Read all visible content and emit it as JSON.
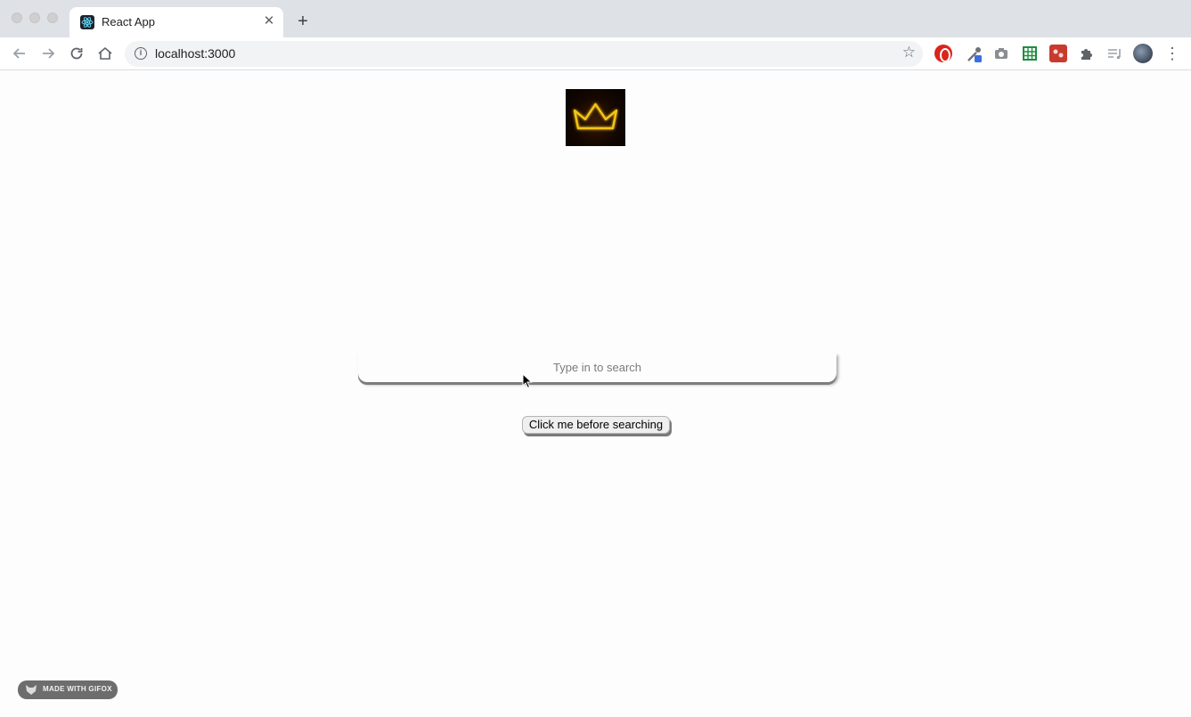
{
  "browser": {
    "tab": {
      "title": "React App",
      "favicon": "react-logo-icon",
      "close_glyph": "✕"
    },
    "new_tab_glyph": "+",
    "address": {
      "url": "localhost:3000",
      "info_glyph": "i"
    },
    "star_glyph": "☆",
    "extensions": [
      "opera-adblock-icon",
      "color-dropper-icon",
      "camera-icon",
      "google-sheets-icon",
      "red-extension-icon",
      "puzzle-icon",
      "media-control-icon"
    ],
    "menu_glyph": "⋮"
  },
  "page": {
    "logo": "crown-logo",
    "search": {
      "placeholder": "Type in to search",
      "value": ""
    },
    "button_label": "Click me before searching",
    "watermark": "MADE WITH GIFOX"
  },
  "colors": {
    "tabstrip": "#dee1e6",
    "crown_glow": "#f5c518",
    "logo_bg": "#140700"
  }
}
